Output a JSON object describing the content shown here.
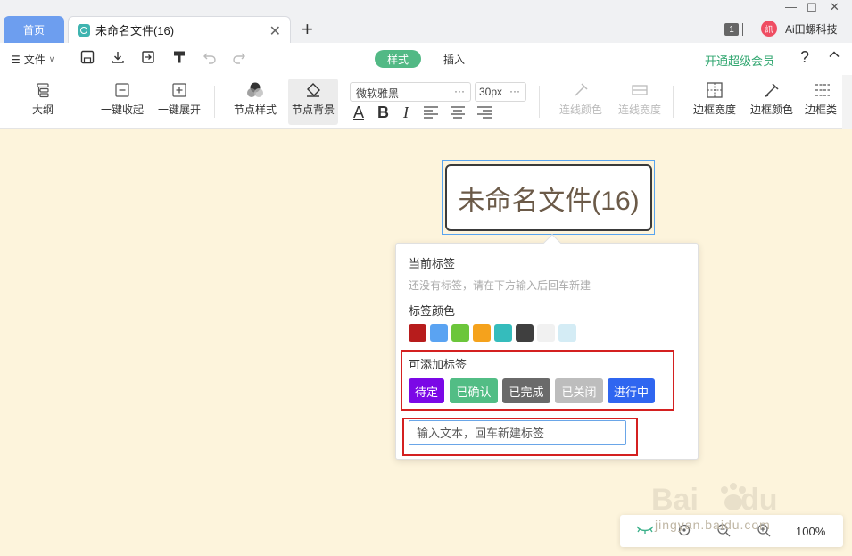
{
  "tabs": {
    "home": "首页",
    "document": "未命名文件(16)"
  },
  "titlebar": {
    "badge_count": "1",
    "user_avatar_text": "訊",
    "user_name": "Ai田螺科技"
  },
  "menubar": {
    "file_label": "文件",
    "style_tab": "样式",
    "insert_tab": "插入",
    "vip_link": "开通超级会员",
    "help_glyph": "?"
  },
  "toolbar": {
    "outline": "大纲",
    "collapse_all": "一键收起",
    "expand_all": "一键展开",
    "node_style": "节点样式",
    "node_background": "节点背景",
    "font_family": "微软雅黑",
    "font_size": "30px",
    "line_color": "连线颜色",
    "line_width": "连线宽度",
    "border_width": "边框宽度",
    "border_color": "边框颜色",
    "border_type": "边框类"
  },
  "canvas": {
    "root_node_text": "未命名文件(16)"
  },
  "tag_popup": {
    "current_tags_title": "当前标签",
    "no_tags_hint": "还没有标签，请在下方输入后回车新建",
    "tag_color_title": "标签颜色",
    "colors": [
      "#b71c1c",
      "#5aa3f2",
      "#6cc63b",
      "#f5a21c",
      "#35bcbc",
      "#3f3f3f",
      "#f1f1f1",
      "#d4ecf5"
    ],
    "available_tags_title": "可添加标签",
    "tags": [
      {
        "label": "待定",
        "color": "#7b08e6"
      },
      {
        "label": "已确认",
        "color": "#52bd85"
      },
      {
        "label": "已完成",
        "color": "#6a6a6a"
      },
      {
        "label": "已关闭",
        "color": "#bdbdbd"
      },
      {
        "label": "进行中",
        "color": "#2f66f0"
      }
    ],
    "input_placeholder": "输入文本，回车新建标签"
  },
  "zoom": {
    "value": "100%"
  },
  "watermark": {
    "text": "jingyan.baidu.com"
  },
  "icons": [
    "doc-tab-icon",
    "close-icon",
    "plus-icon",
    "minimize-icon",
    "maximize-icon",
    "window-close-icon",
    "menu-icon",
    "save-icon",
    "download-icon",
    "export-icon",
    "format-painter-icon",
    "undo-icon",
    "redo-icon",
    "help-icon",
    "chevron-up-icon",
    "outline-icon",
    "collapse-icon",
    "expand-icon",
    "node-style-icon",
    "node-background-icon",
    "eye-icon",
    "locate-icon",
    "zoom-out-icon",
    "zoom-in-icon"
  ]
}
